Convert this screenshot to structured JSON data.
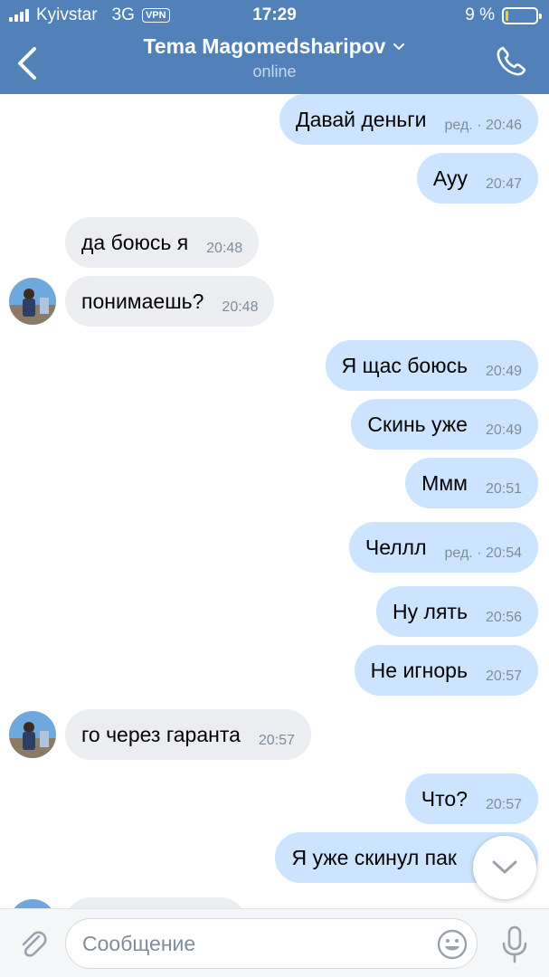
{
  "status_bar": {
    "carrier": "Kyivstar",
    "network": "3G",
    "vpn": "VPN",
    "time": "17:29",
    "battery_percent": "9 %",
    "battery_level": 0.09
  },
  "header": {
    "title": "Tema Magomedsharipov",
    "subtitle": "online"
  },
  "messages": [
    {
      "dir": "out",
      "text": "Давай деньги",
      "edited": "ред. ·",
      "time": "20:46"
    },
    {
      "dir": "out",
      "text": "Ауу",
      "time": "20:47"
    },
    {
      "dir": "in",
      "text": "да боюсь я",
      "time": "20:48"
    },
    {
      "dir": "in",
      "text": "понимаешь?",
      "time": "20:48",
      "avatar": true
    },
    {
      "dir": "out",
      "text": "Я щас боюсь",
      "time": "20:49"
    },
    {
      "dir": "out",
      "text": "Скинь уже",
      "time": "20:49"
    },
    {
      "dir": "out",
      "text": "Ммм",
      "time": "20:51"
    },
    {
      "dir": "out",
      "text": "Челлл",
      "edited": "ред. ·",
      "time": "20:54"
    },
    {
      "dir": "out",
      "text": "Ну лять",
      "time": "20:56"
    },
    {
      "dir": "out",
      "text": "Не игнорь",
      "time": "20:57"
    },
    {
      "dir": "in",
      "text": "го через гаранта",
      "time": "20:57",
      "avatar": true
    },
    {
      "dir": "out",
      "text": "Что?",
      "time": "20:57"
    },
    {
      "dir": "out",
      "text": "Я уже скинул пак",
      "time": ""
    }
  ],
  "composer": {
    "placeholder": "Сообщение"
  },
  "colors": {
    "header": "#5181b8",
    "outgoing_bubble": "#cce4ff",
    "incoming_bubble": "#ebedf0",
    "battery": "#f2c94c"
  },
  "icons": {
    "back": "chevron-left-icon",
    "call": "phone-icon",
    "title_menu": "chevron-down-icon",
    "attach": "paperclip-icon",
    "emoji": "smiley-icon",
    "mic": "microphone-icon",
    "scroll": "chevron-down-icon"
  }
}
